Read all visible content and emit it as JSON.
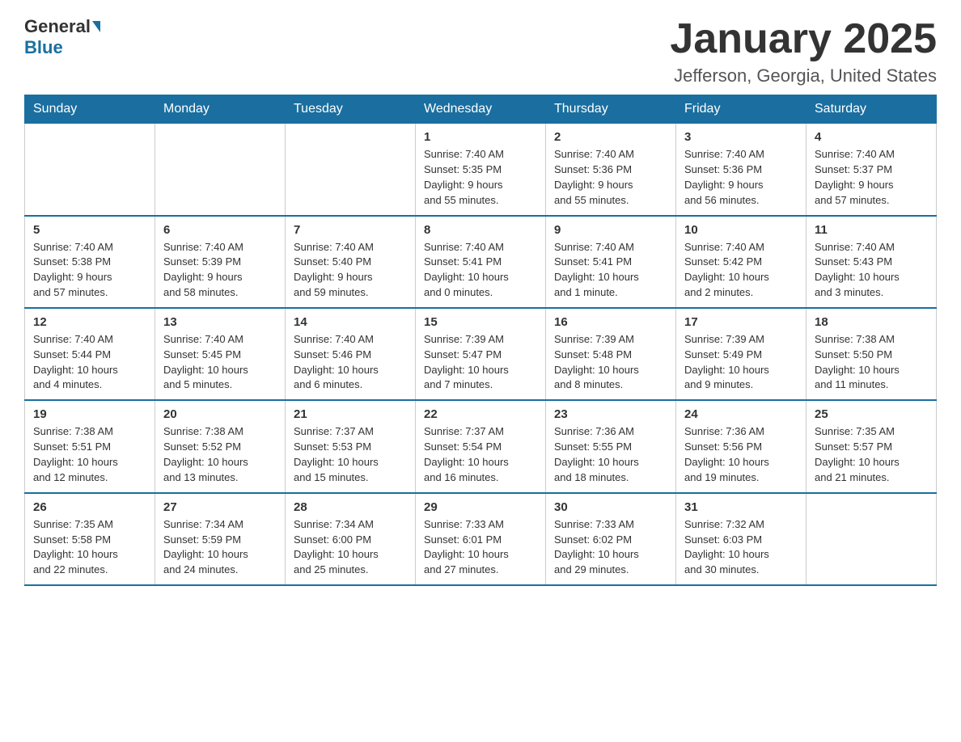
{
  "header": {
    "logo_general": "General",
    "logo_blue": "Blue",
    "title": "January 2025",
    "subtitle": "Jefferson, Georgia, United States"
  },
  "days_of_week": [
    "Sunday",
    "Monday",
    "Tuesday",
    "Wednesday",
    "Thursday",
    "Friday",
    "Saturday"
  ],
  "weeks": [
    [
      {
        "day": "",
        "info": ""
      },
      {
        "day": "",
        "info": ""
      },
      {
        "day": "",
        "info": ""
      },
      {
        "day": "1",
        "info": "Sunrise: 7:40 AM\nSunset: 5:35 PM\nDaylight: 9 hours\nand 55 minutes."
      },
      {
        "day": "2",
        "info": "Sunrise: 7:40 AM\nSunset: 5:36 PM\nDaylight: 9 hours\nand 55 minutes."
      },
      {
        "day": "3",
        "info": "Sunrise: 7:40 AM\nSunset: 5:36 PM\nDaylight: 9 hours\nand 56 minutes."
      },
      {
        "day": "4",
        "info": "Sunrise: 7:40 AM\nSunset: 5:37 PM\nDaylight: 9 hours\nand 57 minutes."
      }
    ],
    [
      {
        "day": "5",
        "info": "Sunrise: 7:40 AM\nSunset: 5:38 PM\nDaylight: 9 hours\nand 57 minutes."
      },
      {
        "day": "6",
        "info": "Sunrise: 7:40 AM\nSunset: 5:39 PM\nDaylight: 9 hours\nand 58 minutes."
      },
      {
        "day": "7",
        "info": "Sunrise: 7:40 AM\nSunset: 5:40 PM\nDaylight: 9 hours\nand 59 minutes."
      },
      {
        "day": "8",
        "info": "Sunrise: 7:40 AM\nSunset: 5:41 PM\nDaylight: 10 hours\nand 0 minutes."
      },
      {
        "day": "9",
        "info": "Sunrise: 7:40 AM\nSunset: 5:41 PM\nDaylight: 10 hours\nand 1 minute."
      },
      {
        "day": "10",
        "info": "Sunrise: 7:40 AM\nSunset: 5:42 PM\nDaylight: 10 hours\nand 2 minutes."
      },
      {
        "day": "11",
        "info": "Sunrise: 7:40 AM\nSunset: 5:43 PM\nDaylight: 10 hours\nand 3 minutes."
      }
    ],
    [
      {
        "day": "12",
        "info": "Sunrise: 7:40 AM\nSunset: 5:44 PM\nDaylight: 10 hours\nand 4 minutes."
      },
      {
        "day": "13",
        "info": "Sunrise: 7:40 AM\nSunset: 5:45 PM\nDaylight: 10 hours\nand 5 minutes."
      },
      {
        "day": "14",
        "info": "Sunrise: 7:40 AM\nSunset: 5:46 PM\nDaylight: 10 hours\nand 6 minutes."
      },
      {
        "day": "15",
        "info": "Sunrise: 7:39 AM\nSunset: 5:47 PM\nDaylight: 10 hours\nand 7 minutes."
      },
      {
        "day": "16",
        "info": "Sunrise: 7:39 AM\nSunset: 5:48 PM\nDaylight: 10 hours\nand 8 minutes."
      },
      {
        "day": "17",
        "info": "Sunrise: 7:39 AM\nSunset: 5:49 PM\nDaylight: 10 hours\nand 9 minutes."
      },
      {
        "day": "18",
        "info": "Sunrise: 7:38 AM\nSunset: 5:50 PM\nDaylight: 10 hours\nand 11 minutes."
      }
    ],
    [
      {
        "day": "19",
        "info": "Sunrise: 7:38 AM\nSunset: 5:51 PM\nDaylight: 10 hours\nand 12 minutes."
      },
      {
        "day": "20",
        "info": "Sunrise: 7:38 AM\nSunset: 5:52 PM\nDaylight: 10 hours\nand 13 minutes."
      },
      {
        "day": "21",
        "info": "Sunrise: 7:37 AM\nSunset: 5:53 PM\nDaylight: 10 hours\nand 15 minutes."
      },
      {
        "day": "22",
        "info": "Sunrise: 7:37 AM\nSunset: 5:54 PM\nDaylight: 10 hours\nand 16 minutes."
      },
      {
        "day": "23",
        "info": "Sunrise: 7:36 AM\nSunset: 5:55 PM\nDaylight: 10 hours\nand 18 minutes."
      },
      {
        "day": "24",
        "info": "Sunrise: 7:36 AM\nSunset: 5:56 PM\nDaylight: 10 hours\nand 19 minutes."
      },
      {
        "day": "25",
        "info": "Sunrise: 7:35 AM\nSunset: 5:57 PM\nDaylight: 10 hours\nand 21 minutes."
      }
    ],
    [
      {
        "day": "26",
        "info": "Sunrise: 7:35 AM\nSunset: 5:58 PM\nDaylight: 10 hours\nand 22 minutes."
      },
      {
        "day": "27",
        "info": "Sunrise: 7:34 AM\nSunset: 5:59 PM\nDaylight: 10 hours\nand 24 minutes."
      },
      {
        "day": "28",
        "info": "Sunrise: 7:34 AM\nSunset: 6:00 PM\nDaylight: 10 hours\nand 25 minutes."
      },
      {
        "day": "29",
        "info": "Sunrise: 7:33 AM\nSunset: 6:01 PM\nDaylight: 10 hours\nand 27 minutes."
      },
      {
        "day": "30",
        "info": "Sunrise: 7:33 AM\nSunset: 6:02 PM\nDaylight: 10 hours\nand 29 minutes."
      },
      {
        "day": "31",
        "info": "Sunrise: 7:32 AM\nSunset: 6:03 PM\nDaylight: 10 hours\nand 30 minutes."
      },
      {
        "day": "",
        "info": ""
      }
    ]
  ]
}
